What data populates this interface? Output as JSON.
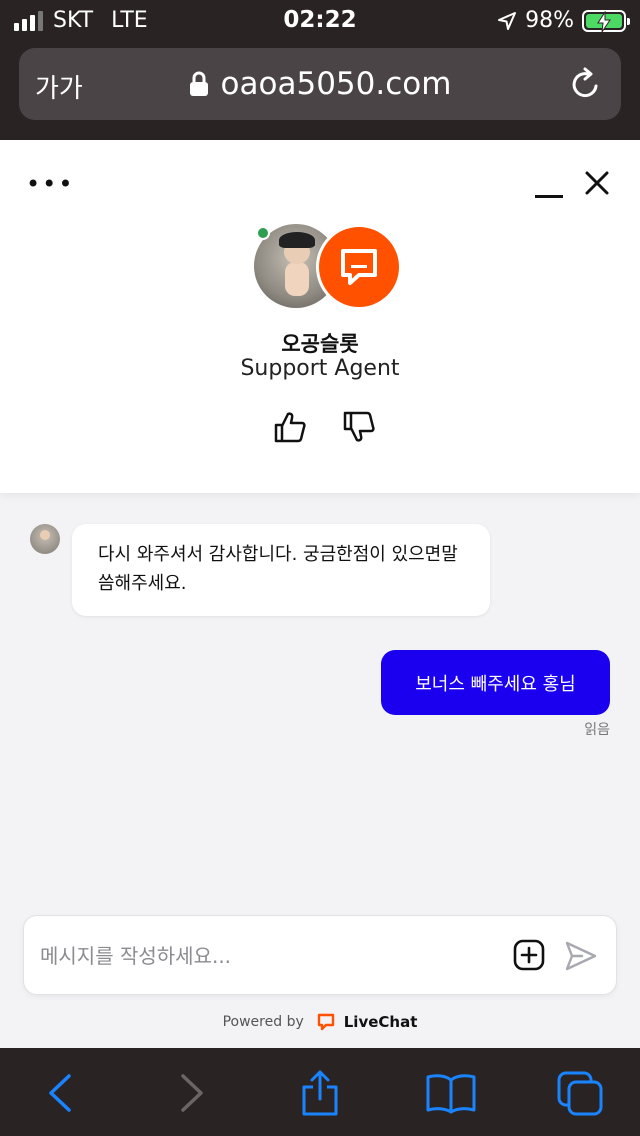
{
  "status_bar": {
    "carrier": "SKT",
    "network": "LTE",
    "time": "02:22",
    "battery": "98%"
  },
  "browser": {
    "text_size_label": "가가",
    "url": "oaoa5050.com"
  },
  "chat": {
    "agent_name": "오공슬롯",
    "agent_role": "Support Agent",
    "messages": [
      {
        "from": "agent",
        "text": "다시 와주셔서 감사합니다. 궁금한점이 있으면말씀해주세요."
      },
      {
        "from": "visitor",
        "text": "보너스 빼주세요 홍님",
        "status": "읽음"
      }
    ],
    "composer_placeholder": "메시지를 작성하세요...",
    "powered_by": "Powered by",
    "brand_name": "LiveChat"
  },
  "colors": {
    "brand_orange": "#ff5100",
    "visitor_bubble": "#1b00f0",
    "online": "#2e9e50",
    "ios_blue": "#1a84ff"
  },
  "icons": [
    "location-arrow-icon",
    "battery-charging-icon",
    "lock-icon",
    "reload-icon",
    "more-options-icon",
    "minimize-icon",
    "close-icon",
    "chat-bubble-icon",
    "thumbs-up-icon",
    "thumbs-down-icon",
    "attach-plus-icon",
    "send-icon",
    "back-icon",
    "forward-icon",
    "share-icon",
    "bookmarks-icon",
    "tabs-icon"
  ]
}
